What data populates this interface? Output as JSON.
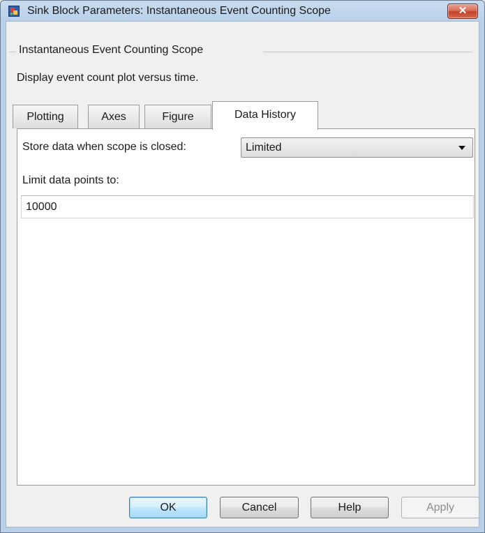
{
  "window": {
    "title": "Sink Block Parameters: Instantaneous Event Counting Scope",
    "close_icon": "close-icon"
  },
  "block": {
    "name": "Instantaneous Event Counting Scope",
    "description": "Display event count plot versus time."
  },
  "tabs": [
    {
      "label": "Plotting",
      "active": false
    },
    {
      "label": "Axes",
      "active": false
    },
    {
      "label": "Figure",
      "active": false
    },
    {
      "label": "Data History",
      "active": true
    }
  ],
  "data_history": {
    "store_label": "Store data when scope is closed:",
    "store_value": "Limited",
    "limit_label": "Limit data points to:",
    "limit_value": "10000"
  },
  "buttons": {
    "ok": "OK",
    "cancel": "Cancel",
    "help": "Help",
    "apply": "Apply"
  }
}
